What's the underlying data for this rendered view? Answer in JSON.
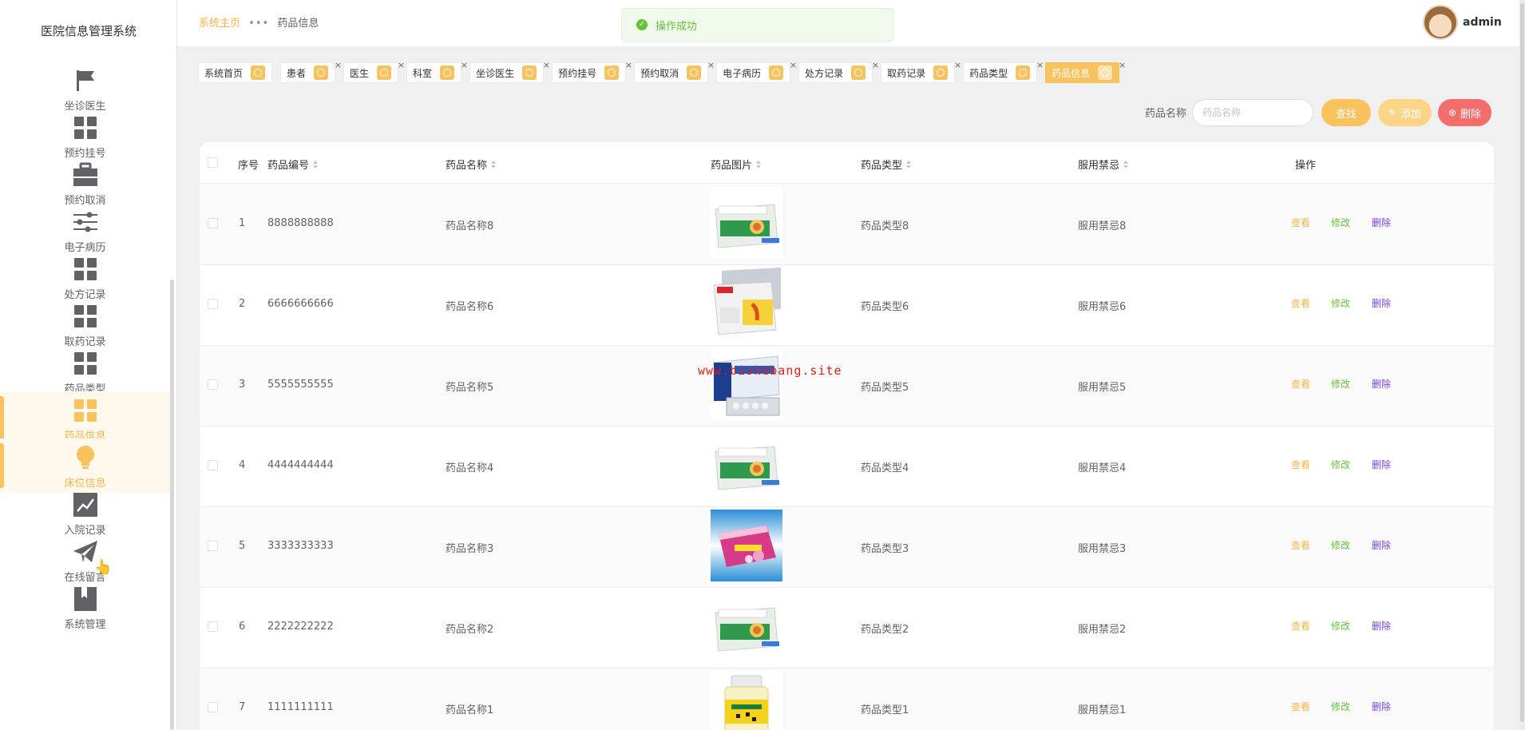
{
  "app": {
    "title": "医院信息管理系统"
  },
  "sidebar": {
    "items": [
      {
        "label": "坐诊医生",
        "icon": "flag-icon",
        "active": false
      },
      {
        "label": "预约挂号",
        "icon": "grid-icon",
        "active": false
      },
      {
        "label": "预约取消",
        "icon": "briefcase-icon",
        "active": false
      },
      {
        "label": "电子病历",
        "icon": "sliders-icon",
        "active": false
      },
      {
        "label": "处方记录",
        "icon": "grid-icon",
        "active": false
      },
      {
        "label": "取药记录",
        "icon": "grid-icon",
        "active": false
      },
      {
        "label": "药品类型",
        "icon": "grid-icon",
        "active": false
      },
      {
        "label": "药品信息",
        "icon": "grid-icon",
        "active": true
      },
      {
        "label": "床位信息",
        "icon": "bulb-icon",
        "active": true
      },
      {
        "label": "入院记录",
        "icon": "trend-chart-icon",
        "active": false
      },
      {
        "label": "在线留言",
        "icon": "paper-plane-icon",
        "active": false
      },
      {
        "label": "系统管理",
        "icon": "bookmark-icon",
        "active": false
      }
    ]
  },
  "header": {
    "breadcrumb_home": "系统主页",
    "breadcrumb_sep": "•••",
    "breadcrumb_current": "药品信息",
    "toast": "操作成功",
    "user": "admin"
  },
  "tabs": [
    {
      "label": "系统首页",
      "closable": false,
      "active": false
    },
    {
      "label": "患者",
      "closable": true,
      "active": false
    },
    {
      "label": "医生",
      "closable": true,
      "active": false
    },
    {
      "label": "科室",
      "closable": true,
      "active": false
    },
    {
      "label": "坐诊医生",
      "closable": true,
      "active": false
    },
    {
      "label": "预约挂号",
      "closable": true,
      "active": false
    },
    {
      "label": "预约取消",
      "closable": true,
      "active": false
    },
    {
      "label": "电子病历",
      "closable": true,
      "active": false
    },
    {
      "label": "处方记录",
      "closable": true,
      "active": false
    },
    {
      "label": "取药记录",
      "closable": true,
      "active": false
    },
    {
      "label": "药品类型",
      "closable": true,
      "active": false
    },
    {
      "label": "药品信息",
      "closable": true,
      "active": true
    }
  ],
  "search": {
    "label": "药品名称",
    "placeholder": "药品名称",
    "search_btn": "查找",
    "add_btn": "添加",
    "delete_btn": "删除"
  },
  "table": {
    "columns": [
      "序号",
      "药品编号",
      "药品名称",
      "药品图片",
      "药品类型",
      "服用禁忌",
      "操作"
    ],
    "actions": {
      "view": "查看",
      "edit": "修改",
      "delete": "删除"
    },
    "rows": [
      {
        "no": "1",
        "code": "8888888888",
        "name": "药品名称8",
        "type": "药品类型8",
        "taboo": "服用禁忌8",
        "img": "box-green"
      },
      {
        "no": "2",
        "code": "6666666666",
        "name": "药品名称6",
        "type": "药品类型6",
        "taboo": "服用禁忌6",
        "img": "box-yellow"
      },
      {
        "no": "3",
        "code": "5555555555",
        "name": "药品名称5",
        "type": "药品类型5",
        "taboo": "服用禁忌5",
        "img": "box-blue"
      },
      {
        "no": "4",
        "code": "4444444444",
        "name": "药品名称4",
        "type": "药品类型4",
        "taboo": "服用禁忌4",
        "img": "box-green"
      },
      {
        "no": "5",
        "code": "3333333333",
        "name": "药品名称3",
        "type": "药品类型3",
        "taboo": "服用禁忌3",
        "img": "box-pink"
      },
      {
        "no": "6",
        "code": "2222222222",
        "name": "药品名称2",
        "type": "药品类型2",
        "taboo": "服用禁忌2",
        "img": "box-green"
      },
      {
        "no": "7",
        "code": "1111111111",
        "name": "药品名称1",
        "type": "药品类型1",
        "taboo": "服用禁忌1",
        "img": "bottle-yellow"
      }
    ]
  },
  "watermark": "www.bishebang.site",
  "colors": {
    "accent": "#f8c25d",
    "danger": "#f56c6c",
    "success": "#67c23a",
    "purple": "#7b3fe4"
  }
}
